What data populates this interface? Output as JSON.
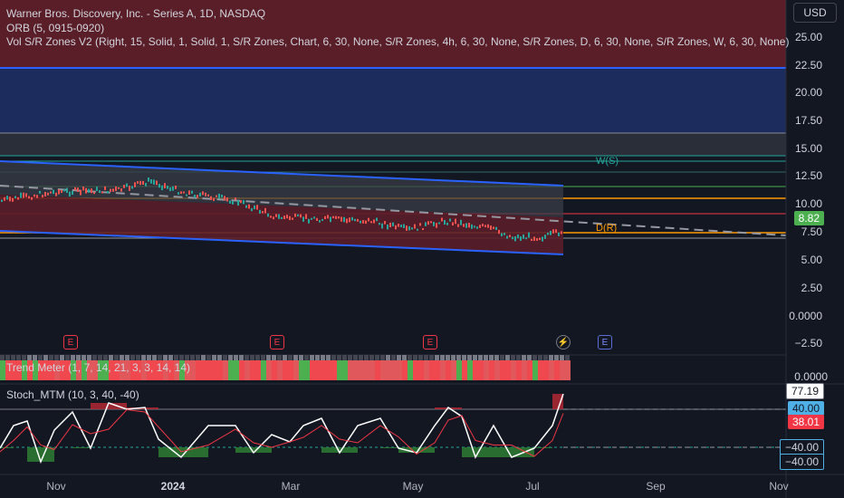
{
  "legend": {
    "symbol": "Warner Bros. Discovery, Inc. - Series A, 1D, NASDAQ",
    "orb": "ORB (5, 0915-0920)",
    "vol_sr": "Vol S/R Zones V2 (Right, 15, Solid, 1, Solid, 1, S/R Zones, Chart, 6, 30, None, S/R Zones, 4h, 6, 30, None, S/R Zones, D, 6, 30, None, S/R Zones, W, 6, 30, None)"
  },
  "currency_button": "USD",
  "price_axis": [
    "25.00",
    "22.50",
    "20.00",
    "17.50",
    "15.00",
    "12.50",
    "10.00",
    "7.50",
    "5.00",
    "2.50",
    "0.0000",
    "−2.50"
  ],
  "current_price": "8.82",
  "level_labels": {
    "w_s": "W(S)",
    "d_r": "D(R)"
  },
  "trend_meter": {
    "title": "Trend Meter (1, 7, 14, 21, 3, 3, 14, 14)",
    "axis_value": "0.0000"
  },
  "stoch": {
    "title": "Stoch_MTM (10, 3, 40, -40)",
    "value_main": "77.19",
    "value_upper": "40.00",
    "value_signal": "38.01",
    "value_lower_a": "−40.00",
    "value_lower_b": "−40.00"
  },
  "time_axis": [
    {
      "label": "Nov",
      "bold": false
    },
    {
      "label": "2024",
      "bold": true
    },
    {
      "label": "Mar",
      "bold": false
    },
    {
      "label": "May",
      "bold": false
    },
    {
      "label": "Jul",
      "bold": false
    },
    {
      "label": "Sep",
      "bold": false
    },
    {
      "label": "Nov",
      "bold": false
    }
  ],
  "event_markers": {
    "earnings": "E",
    "dividend": "⚡"
  },
  "colors": {
    "background": "#131722",
    "up": "#4caf50",
    "down": "#f23645",
    "resistance_zone": "#5c1f2a",
    "support_zone": "#1e2a55",
    "accent_blue": "#2962ff",
    "teal": "#26a69a",
    "orange": "#ff9800"
  }
}
